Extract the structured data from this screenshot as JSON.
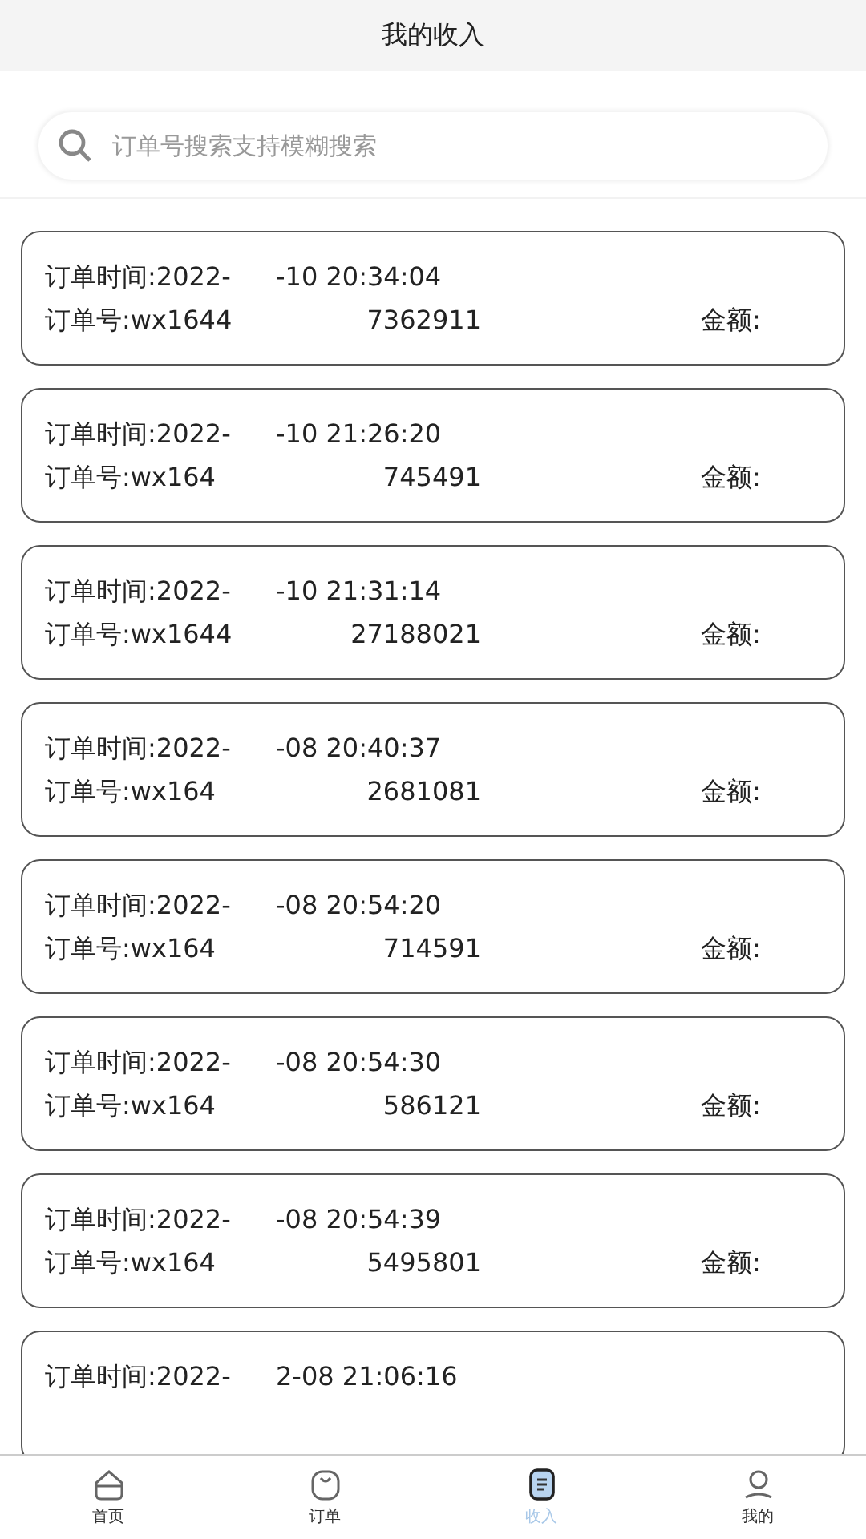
{
  "header": {
    "title": "我的收入"
  },
  "search": {
    "placeholder": "订单号搜索支持模糊搜索"
  },
  "orders": [
    {
      "time_prefix": "订单时间:2022-",
      "time_suffix": "-10 20:34:04",
      "number_prefix": "订单号:wx1644",
      "number_suffix": "7362911",
      "amount_label": "金额:"
    },
    {
      "time_prefix": "订单时间:2022-",
      "time_suffix": "-10 21:26:20",
      "number_prefix": "订单号:wx164",
      "number_suffix": "745491",
      "amount_label": "金额:"
    },
    {
      "time_prefix": "订单时间:2022-",
      "time_suffix": "-10 21:31:14",
      "number_prefix": "订单号:wx1644",
      "number_suffix": "27188021",
      "amount_label": "金额:"
    },
    {
      "time_prefix": "订单时间:2022-",
      "time_suffix": "-08 20:40:37",
      "number_prefix": "订单号:wx164",
      "number_suffix": "2681081",
      "amount_label": "金额:"
    },
    {
      "time_prefix": "订单时间:2022-",
      "time_suffix": "-08 20:54:20",
      "number_prefix": "订单号:wx164",
      "number_suffix": "714591",
      "amount_label": "金额:"
    },
    {
      "time_prefix": "订单时间:2022-",
      "time_suffix": "-08 20:54:30",
      "number_prefix": "订单号:wx164",
      "number_suffix": "586121",
      "amount_label": "金额:"
    },
    {
      "time_prefix": "订单时间:2022-",
      "time_suffix": "-08 20:54:39",
      "number_prefix": "订单号:wx164",
      "number_suffix": "5495801",
      "amount_label": "金额:"
    },
    {
      "time_prefix": "订单时间:2022-",
      "time_suffix": "2-08 21:06:16"
    }
  ],
  "tab_bar": [
    {
      "kind": "home",
      "label": "首页",
      "selected": false
    },
    {
      "kind": "orders",
      "label": "订单",
      "selected": false
    },
    {
      "kind": "income",
      "label": "收入",
      "selected": true
    },
    {
      "kind": "profile",
      "label": "我的",
      "selected": false
    }
  ]
}
